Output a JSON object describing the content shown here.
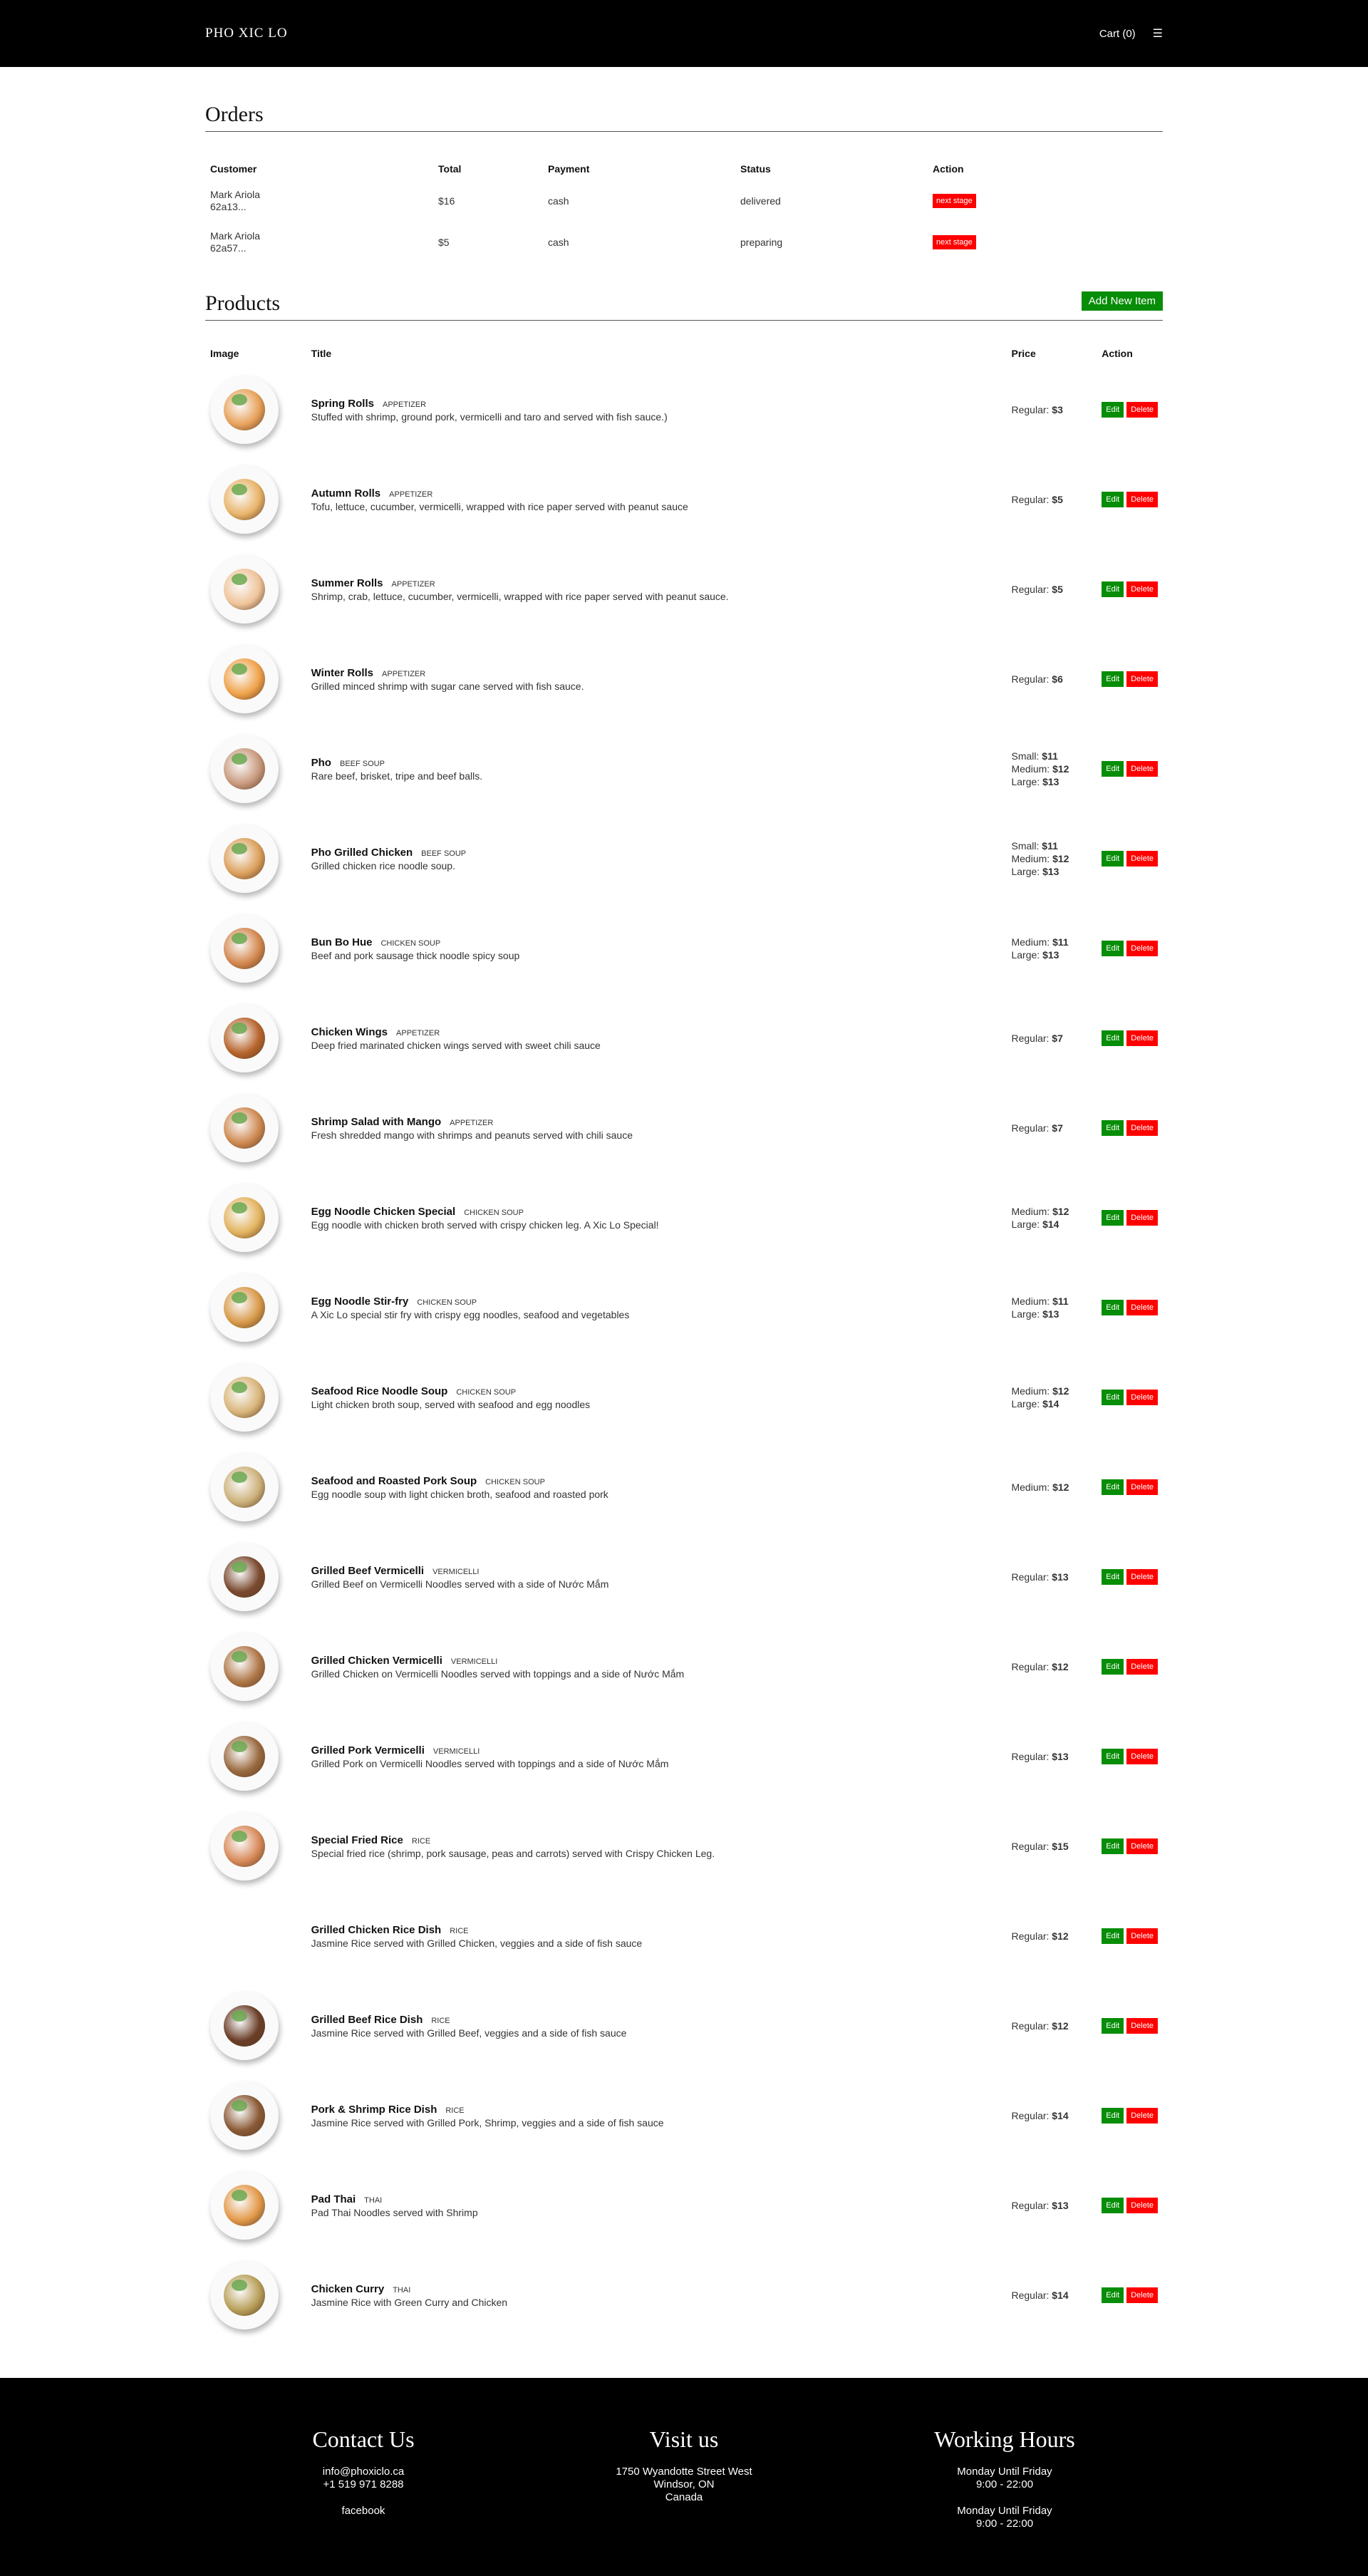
{
  "nav": {
    "brand": "PHO XIC LO",
    "cart": "Cart (0)",
    "menu_icon": "hamburger-icon",
    "menu_glyph": "☰"
  },
  "orders": {
    "title": "Orders",
    "headers": [
      "Customer",
      "Total",
      "Payment",
      "Status",
      "Action"
    ],
    "rows": [
      {
        "name": "Mark Ariola",
        "id": "62a13...",
        "total": "$16",
        "payment": "cash",
        "status": "delivered",
        "action": "next stage"
      },
      {
        "name": "Mark Ariola",
        "id": "62a57...",
        "total": "$5",
        "payment": "cash",
        "status": "preparing",
        "action": "next stage"
      }
    ]
  },
  "products": {
    "title": "Products",
    "add_button": "Add New Item",
    "headers": [
      "Image",
      "Title",
      "Price",
      "Action"
    ],
    "edit_label": "Edit",
    "delete_label": "Delete",
    "items": [
      {
        "title": "Spring Rolls",
        "category": "APPETIZER",
        "desc": "Stuffed with shrimp, ground pork, vermicelli and taro and served with fish sauce.)",
        "prices": [
          [
            "Regular:",
            "$3"
          ]
        ],
        "color": "#e8a25a"
      },
      {
        "title": "Autumn Rolls",
        "category": "APPETIZER",
        "desc": "Tofu, lettuce, cucumber, vermicelli, wrapped with rice paper served with peanut sauce",
        "prices": [
          [
            "Regular:",
            "$5"
          ]
        ],
        "color": "#e9b46a"
      },
      {
        "title": "Summer Rolls",
        "category": "APPETIZER",
        "desc": "Shrimp, crab, lettuce, cucumber, vermicelli, wrapped with rice paper served with peanut sauce.",
        "prices": [
          [
            "Regular:",
            "$5"
          ]
        ],
        "color": "#efc49a"
      },
      {
        "title": "Winter Rolls",
        "category": "APPETIZER",
        "desc": "Grilled minced shrimp with sugar cane served with fish sauce.",
        "prices": [
          [
            "Regular:",
            "$6"
          ]
        ],
        "color": "#f0a24a"
      },
      {
        "title": "Pho",
        "category": "BEEF SOUP",
        "desc": "Rare beef, brisket, tripe and beef balls.",
        "prices": [
          [
            "Small:",
            "$11"
          ],
          [
            "Medium:",
            "$12"
          ],
          [
            "Large:",
            "$13"
          ]
        ],
        "color": "#c99a7e"
      },
      {
        "title": "Pho Grilled Chicken",
        "category": "BEEF SOUP",
        "desc": "Grilled chicken rice noodle soup.",
        "prices": [
          [
            "Small:",
            "$11"
          ],
          [
            "Medium:",
            "$12"
          ],
          [
            "Large:",
            "$13"
          ]
        ],
        "color": "#dca05c"
      },
      {
        "title": "Bun Bo Hue",
        "category": "CHICKEN SOUP",
        "desc": "Beef and pork sausage thick noodle spicy soup",
        "prices": [
          [
            "Medium:",
            "$11"
          ],
          [
            "Large:",
            "$13"
          ]
        ],
        "color": "#d4884f"
      },
      {
        "title": "Chicken Wings",
        "category": "APPETIZER",
        "desc": "Deep fried marinated chicken wings served with sweet chili sauce",
        "prices": [
          [
            "Regular:",
            "$7"
          ]
        ],
        "color": "#b7642c"
      },
      {
        "title": "Shrimp Salad with Mango",
        "category": "APPETIZER",
        "desc": "Fresh shredded mango with shrimps and peanuts served with chili sauce",
        "prices": [
          [
            "Regular:",
            "$7"
          ]
        ],
        "color": "#cf8a52"
      },
      {
        "title": "Egg Noodle Chicken Special",
        "category": "CHICKEN SOUP",
        "desc": "Egg noodle with chicken broth served with crispy chicken leg. A Xic Lo Special!",
        "prices": [
          [
            "Medium:",
            "$12"
          ],
          [
            "Large:",
            "$14"
          ]
        ],
        "color": "#e3b35e"
      },
      {
        "title": "Egg Noodle Stir-fry",
        "category": "CHICKEN SOUP",
        "desc": "A Xic Lo special stir fry with crispy egg noodles, seafood and vegetables",
        "prices": [
          [
            "Medium:",
            "$11"
          ],
          [
            "Large:",
            "$13"
          ]
        ],
        "color": "#d89a4a"
      },
      {
        "title": "Seafood Rice Noodle Soup",
        "category": "CHICKEN SOUP",
        "desc": "Light chicken broth soup, served with seafood and egg noodles",
        "prices": [
          [
            "Medium:",
            "$12"
          ],
          [
            "Large:",
            "$14"
          ]
        ],
        "color": "#d9b57a"
      },
      {
        "title": "Seafood and Roasted Pork Soup",
        "category": "CHICKEN SOUP",
        "desc": "Egg noodle soup with light chicken broth, seafood and roasted pork",
        "prices": [
          [
            "Medium:",
            "$12"
          ]
        ],
        "color": "#cdb27c"
      },
      {
        "title": "Grilled Beef Vermicelli",
        "category": "VERMICELLI",
        "desc": "Grilled Beef on Vermicelli Noodles served with a side of Nước Mắm",
        "prices": [
          [
            "Regular:",
            "$13"
          ]
        ],
        "color": "#7a4a30"
      },
      {
        "title": "Grilled Chicken Vermicelli",
        "category": "VERMICELLI",
        "desc": "Grilled Chicken on Vermicelli Noodles served with toppings and a side of Nước Mắm",
        "prices": [
          [
            "Regular:",
            "$12"
          ]
        ],
        "color": "#b07848"
      },
      {
        "title": "Grilled Pork Vermicelli",
        "category": "VERMICELLI",
        "desc": "Grilled Pork on Vermicelli Noodles served with toppings and a side of Nước Mắm",
        "prices": [
          [
            "Regular:",
            "$13"
          ]
        ],
        "color": "#9a6a40"
      },
      {
        "title": "Special Fried Rice",
        "category": "RICE",
        "desc": "Special fried rice (shrimp, pork sausage, peas and carrots) served with Crispy Chicken Leg.",
        "prices": [
          [
            "Regular:",
            "$15"
          ]
        ],
        "color": "#d88a5a"
      },
      {
        "title": "Grilled Chicken Rice Dish",
        "category": "RICE",
        "desc": "Jasmine Rice served with Grilled Chicken, veggies and a side of fish sauce",
        "prices": [
          [
            "Regular:",
            "$12"
          ]
        ],
        "color": "",
        "no_image": true
      },
      {
        "title": "Grilled Beef Rice Dish",
        "category": "RICE",
        "desc": "Jasmine Rice served with Grilled Beef, veggies and a side of fish sauce",
        "prices": [
          [
            "Regular:",
            "$12"
          ]
        ],
        "color": "#6a3e28"
      },
      {
        "title": "Pork & Shrimp Rice Dish",
        "category": "RICE",
        "desc": "Jasmine Rice served with Grilled Pork, Shrimp, veggies and a side of fish sauce",
        "prices": [
          [
            "Regular:",
            "$14"
          ]
        ],
        "color": "#8a5a36"
      },
      {
        "title": "Pad Thai",
        "category": "THAI",
        "desc": "Pad Thai Noodles served with Shrimp",
        "prices": [
          [
            "Regular:",
            "$13"
          ]
        ],
        "color": "#e39a4a"
      },
      {
        "title": "Chicken Curry",
        "category": "THAI",
        "desc": "Jasmine Rice with Green Curry and Chicken",
        "prices": [
          [
            "Regular:",
            "$14"
          ]
        ],
        "color": "#b9a05a"
      }
    ]
  },
  "footer": {
    "contact": {
      "title": "Contact Us",
      "email": "info@phoxiclo.ca",
      "phone": "+1 519 971 8288",
      "social": "facebook"
    },
    "visit": {
      "title": "Visit us",
      "street": "1750 Wyandotte Street West",
      "city": "Windsor, ON",
      "country": "Canada"
    },
    "hours": {
      "title": "Working Hours",
      "line1_days": "Monday Until Friday",
      "line1_time": "9:00 - 22:00",
      "line2_days": "Monday Until Friday",
      "line2_time": "9:00 - 22:00"
    }
  },
  "colors": {
    "nav_bg": "#000000",
    "edit_green": "#078d07",
    "delete_red": "#ff0000"
  }
}
